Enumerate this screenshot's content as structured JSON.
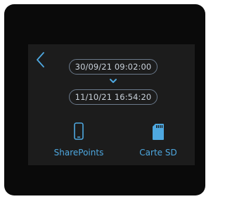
{
  "screen": {
    "start_datetime": "30/09/21 09:02:00",
    "end_datetime": "11/10/21 16:54:20"
  },
  "actions": {
    "share_label": "SharePoints",
    "sd_label": "Carte SD"
  },
  "icons": {
    "back": "chevron-left-icon",
    "arrow": "chevron-down-icon",
    "share": "smartphone-icon",
    "sd": "sd-card-icon"
  },
  "colors": {
    "accent": "#4ea8e0",
    "text": "#c9d1da",
    "border": "#6b7a8c",
    "screen_bg": "#1c1c1c",
    "bezel": "#0a0a0a"
  }
}
